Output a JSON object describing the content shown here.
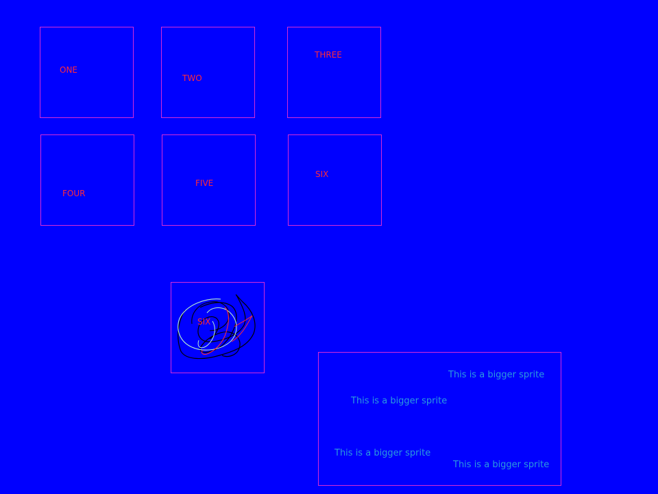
{
  "scene": {
    "background_color": "#0000ff",
    "sprite_border_color": "#d62bd6",
    "label_color": "#ff2a3a",
    "big_label_color": "#2b9bdd"
  },
  "sprites": [
    {
      "label": "ONE"
    },
    {
      "label": "TWO"
    },
    {
      "label": "THREE"
    },
    {
      "label": "FOUR"
    },
    {
      "label": "FIVE"
    },
    {
      "label": "SIX"
    },
    {
      "label": "SIX",
      "has_scribble": true
    }
  ],
  "big_sprite": {
    "labels": [
      "This is a bigger sprite",
      "This is a bigger sprite",
      "This is a bigger sprite",
      "This is a bigger sprite"
    ]
  }
}
